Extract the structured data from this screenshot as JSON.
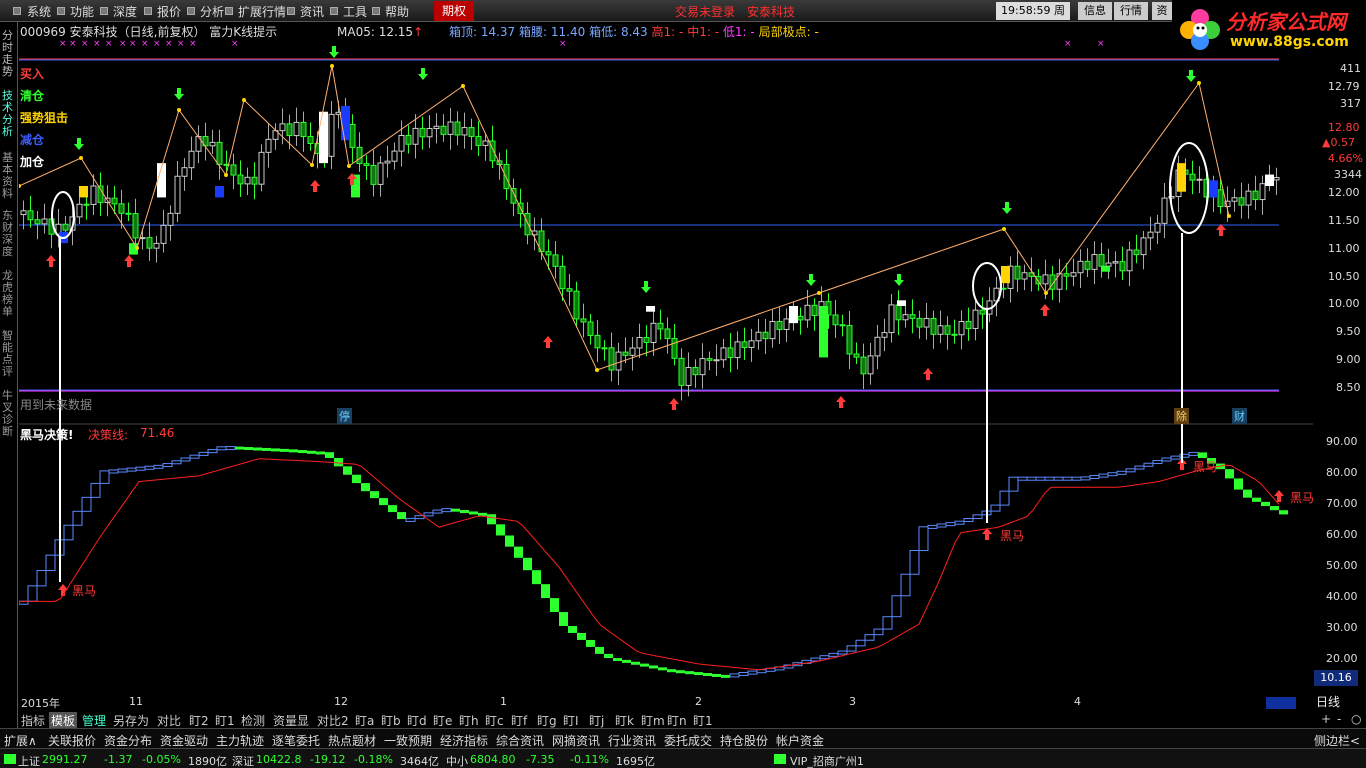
{
  "menu": {
    "items": [
      "系统",
      "功能",
      "深度",
      "报价",
      "分析",
      "扩展行情",
      "资讯",
      "工具",
      "帮助"
    ],
    "option_tab": "期权",
    "login_status": "交易未登录",
    "company": "安泰科技"
  },
  "clock": {
    "time": "19:58:59",
    "weekday": "周三"
  },
  "top_buttons": {
    "info": "信息",
    "quote": "行情",
    "extra": "资"
  },
  "logo": {
    "title": "分析家公式网",
    "url": "www.88gs.com"
  },
  "left_tabs": [
    "分时走势",
    "技术分析",
    "基本资料",
    "东财深度",
    "龙虎榜单",
    "智能点评",
    "牛叉诊断"
  ],
  "chart_info": {
    "code": "000969",
    "name": "安泰科技（日线,前复权）",
    "indicator": "富力K线提示",
    "ma_label": "MA05:",
    "ma_value": "12.15",
    "box_top_label": "箱顶:",
    "box_top_value": "14.37",
    "box_waist_label": "箱腰:",
    "box_waist_value": "11.40",
    "box_low_label": "箱低:",
    "box_low_value": "8.43",
    "high_label": "高1:",
    "high_value": "-",
    "mid_label": "中1:",
    "mid_value": "-",
    "low_label": "低1:",
    "low_value": "-",
    "local_label": "局部极点:",
    "local_value": "-"
  },
  "legend": {
    "buy": "买入",
    "clear": "清仓",
    "strong": "强势狙击",
    "reduce": "减仓",
    "add": "加仓",
    "future_data": "用到未来数据"
  },
  "price_axis": [
    "411",
    "12.79",
    "317",
    "12.80",
    "▲0.57",
    "4.66%",
    "3344",
    "12.00",
    "11.50",
    "11.00",
    "10.50",
    "10.00",
    "9.50",
    "9.00",
    "8.50"
  ],
  "sub_indicator": {
    "title": "黑马决策!",
    "line_label": "决策线:",
    "line_value": "71.46",
    "axis": [
      "90.00",
      "80.00",
      "70.00",
      "60.00",
      "50.00",
      "40.00",
      "30.00",
      "20.00"
    ],
    "current_value": "10.16",
    "signal_text": "黑马"
  },
  "markers": {
    "stop": "停",
    "cai": "财",
    "fu": "除"
  },
  "date_axis": [
    "2015年",
    "11",
    "12",
    "1",
    "2",
    "3",
    "4"
  ],
  "period": "日线",
  "bottom_toolbar": [
    "指标",
    "模板",
    "管理",
    "另存为",
    "对比",
    "盯2",
    "盯1",
    "检测",
    "资量显",
    "对比2",
    "盯a",
    "盯b",
    "盯d",
    "盯e",
    "盯h",
    "盯c",
    "盯f",
    "盯g",
    "盯I",
    "盯j",
    "盯k",
    "盯m",
    "盯n",
    "盯1"
  ],
  "toolbar_right": [
    "+",
    "-",
    "○"
  ],
  "func_bar": [
    "扩展∧",
    "关联报价",
    "资金分布",
    "资金驱动",
    "主力轨迹",
    "逐笔委托",
    "热点题材",
    "一致预期",
    "经济指标",
    "综合资讯",
    "网摘资讯",
    "行业资讯",
    "委托成交",
    "持仓股份",
    "帐户资金"
  ],
  "func_right": "侧边栏<",
  "status": {
    "sh_label": "上证",
    "sh_value": "2991.27",
    "sh_change": "-1.37",
    "sh_pct": "-0.05%",
    "sh_vol": "1890亿",
    "sz_label": "深证",
    "sz_value": "10422.8",
    "sz_change": "-19.12",
    "sz_pct": "-0.18%",
    "sz_vol": "3464亿",
    "zx_label": "中小",
    "zx_value": "6804.80",
    "zx_change": "-7.35",
    "zx_pct": "-0.11%",
    "zx_vol": "1695亿",
    "broker": "VIP_招商广州1"
  },
  "colors": {
    "up": "#ff3b3b",
    "down": "#2eff2e",
    "box_line": "#3060ff",
    "cyan": "#40e0e0",
    "magenta": "#ff40ff",
    "gold": "#ffd400"
  }
}
